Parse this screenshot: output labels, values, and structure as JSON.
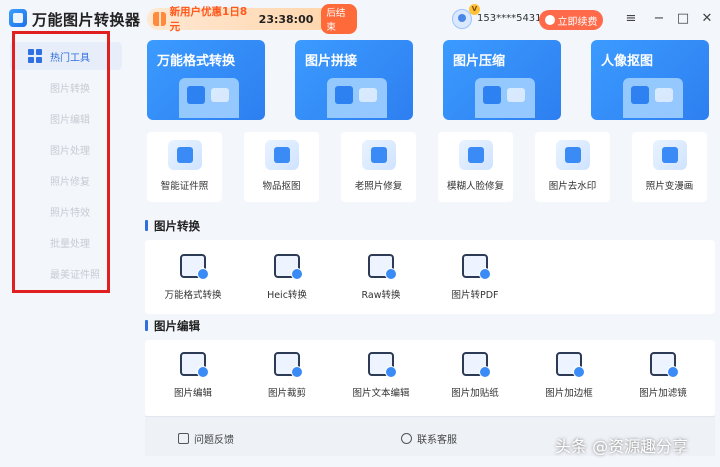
{
  "app": {
    "title": "万能图片转换器"
  },
  "promo": {
    "text": "新用户优惠1日8元",
    "time": "23:38:00",
    "end_label": "后结束"
  },
  "user": {
    "vip": "V",
    "name": "153****5431",
    "renew_label": "立即续费"
  },
  "window_controls": {
    "menu": "≡",
    "minimize": "−",
    "maximize": "□",
    "close": "✕"
  },
  "sidebar": {
    "items": [
      {
        "label": "热门工具",
        "active": true
      },
      {
        "label": "图片转换"
      },
      {
        "label": "图片编辑"
      },
      {
        "label": "图片处理"
      },
      {
        "label": "照片修复"
      },
      {
        "label": "照片特效"
      },
      {
        "label": "批量处理"
      },
      {
        "label": "最美证件照"
      }
    ]
  },
  "feature_cards": [
    {
      "title": "万能格式转换"
    },
    {
      "title": "图片拼接"
    },
    {
      "title": "图片压缩"
    },
    {
      "title": "人像抠图"
    }
  ],
  "hot_tools": [
    {
      "label": "智能证件照"
    },
    {
      "label": "物品抠图"
    },
    {
      "label": "老照片修复"
    },
    {
      "label": "模糊人脸修复"
    },
    {
      "label": "图片去水印"
    },
    {
      "label": "照片变漫画"
    }
  ],
  "sections": {
    "convert": {
      "title": "图片转换",
      "tools": [
        {
          "label": "万能格式转换"
        },
        {
          "label": "Heic转换"
        },
        {
          "label": "Raw转换"
        },
        {
          "label": "图片转PDF"
        }
      ]
    },
    "edit": {
      "title": "图片编辑",
      "tools": [
        {
          "label": "图片编辑"
        },
        {
          "label": "图片裁剪"
        },
        {
          "label": "图片文本编辑"
        },
        {
          "label": "图片加贴纸"
        },
        {
          "label": "图片加边框"
        },
        {
          "label": "图片加滤镜"
        }
      ]
    }
  },
  "bottom_bar": {
    "feedback": "问题反馈",
    "support": "联系客服"
  },
  "watermark": "头条 @资源趣分享",
  "colors": {
    "accent": "#2f6fe0",
    "card_blue": "#3b9bff",
    "promo_orange": "#ff5a1f",
    "renew_red": "#ff6b4a",
    "highlight_box": "#e02020"
  }
}
